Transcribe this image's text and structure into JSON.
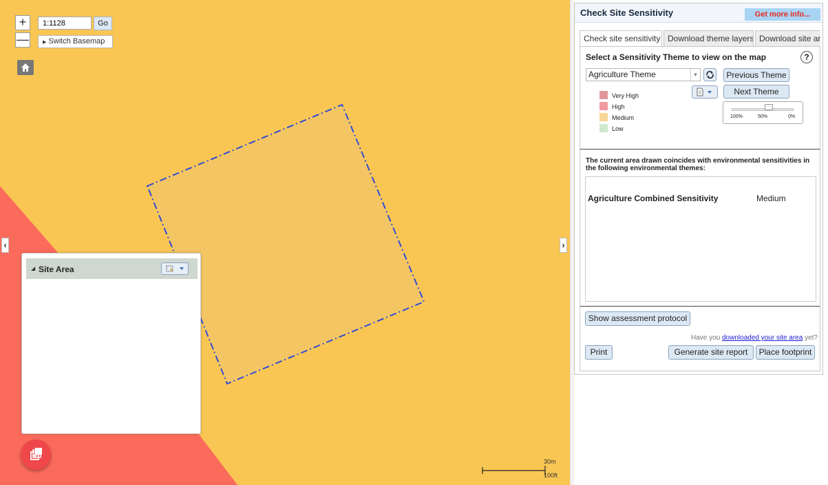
{
  "map": {
    "scale_value": "1:1128",
    "go_label": "Go",
    "switch_basemap_label": "Switch Basemap",
    "zoom_in": "+",
    "zoom_out": "—",
    "scale_bar_metric": "30m",
    "scale_bar_imperial": "100ft",
    "colors": {
      "medium": "#f9c653",
      "high": "#fb6b5b",
      "polygon_line": "#2f4bd6"
    }
  },
  "site_area": {
    "title": "Site Area"
  },
  "panel": {
    "title": "Check Site Sensitivity",
    "more_info": "Get more info...",
    "tabs": [
      {
        "label": "Check site sensitivity",
        "active": true
      },
      {
        "label": "Download theme layers",
        "active": false
      },
      {
        "label": "Download site area",
        "active": false
      }
    ],
    "select_heading": "Select a Sensitivity Theme to view on the map",
    "help": "?",
    "theme_selected": "Agriculture Theme",
    "previous_theme": "Previous Theme",
    "next_theme": "Next Theme",
    "legend": [
      {
        "label": "Very High",
        "color": "#e0979b"
      },
      {
        "label": "High",
        "color": "#f19aa0"
      },
      {
        "label": "Medium",
        "color": "#f9d794"
      },
      {
        "label": "Low",
        "color": "#cfe9cc"
      }
    ],
    "opacity": {
      "labels": [
        "100%",
        "50%",
        "0%"
      ],
      "value": 0.5
    },
    "coincide_text": "The current area drawn coincides with environmental sensitivities in the following environmental themes:",
    "results": [
      {
        "theme": "Agriculture Combined Sensitivity",
        "value": "Medium"
      }
    ],
    "show_protocol": "Show assessment protocol",
    "download_prompt_pre": "Have you ",
    "download_prompt_link": "downloaded your site area",
    "download_prompt_post": " yet?",
    "print": "Print",
    "generate_report": "Generate site report",
    "place_footprint": "Place footprint"
  }
}
